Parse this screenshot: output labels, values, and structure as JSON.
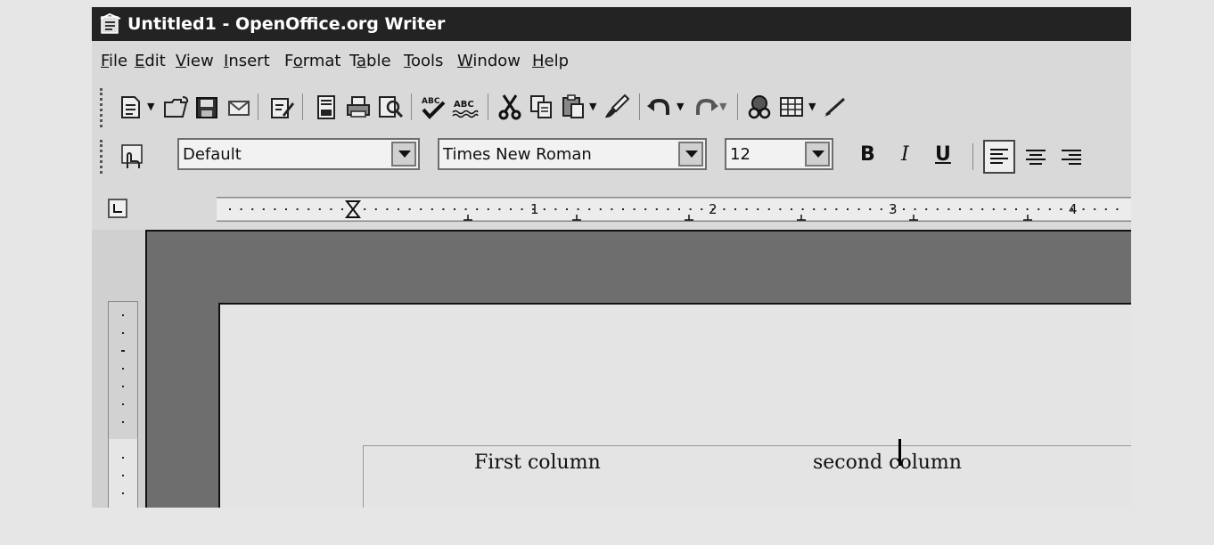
{
  "window": {
    "title": "Untitled1 - OpenOffice.org Writer",
    "icon": "writer-app-icon"
  },
  "menu": [
    {
      "label": "File",
      "accel": "F",
      "rest": "ile"
    },
    {
      "label": "Edit",
      "accel": "E",
      "rest": "dit"
    },
    {
      "label": "View",
      "accel": "V",
      "rest": "iew"
    },
    {
      "label": "Insert",
      "accel": "I",
      "rest": "nsert"
    },
    {
      "label": "Format",
      "pre": "F",
      "accel": "o",
      "rest": "rmat"
    },
    {
      "label": "Table",
      "pre": "T",
      "accel": "a",
      "rest": "ble"
    },
    {
      "label": "Tools",
      "accel": "T",
      "rest": "ools"
    },
    {
      "label": "Window",
      "accel": "W",
      "rest": "indow"
    },
    {
      "label": "Help",
      "accel": "H",
      "rest": "elp"
    }
  ],
  "formatting": {
    "style": "Default",
    "font": "Times New Roman",
    "size": "12",
    "bold": "B",
    "italic": "I",
    "underline": "U"
  },
  "ruler": {
    "numbers": [
      "1",
      "2",
      "3",
      "4"
    ]
  },
  "document": {
    "cell1": "First column",
    "cell2": "second column"
  },
  "colors": {
    "titlebar": "#232323",
    "workspace": "#6e6e6e",
    "page": "#e4e4e4"
  }
}
